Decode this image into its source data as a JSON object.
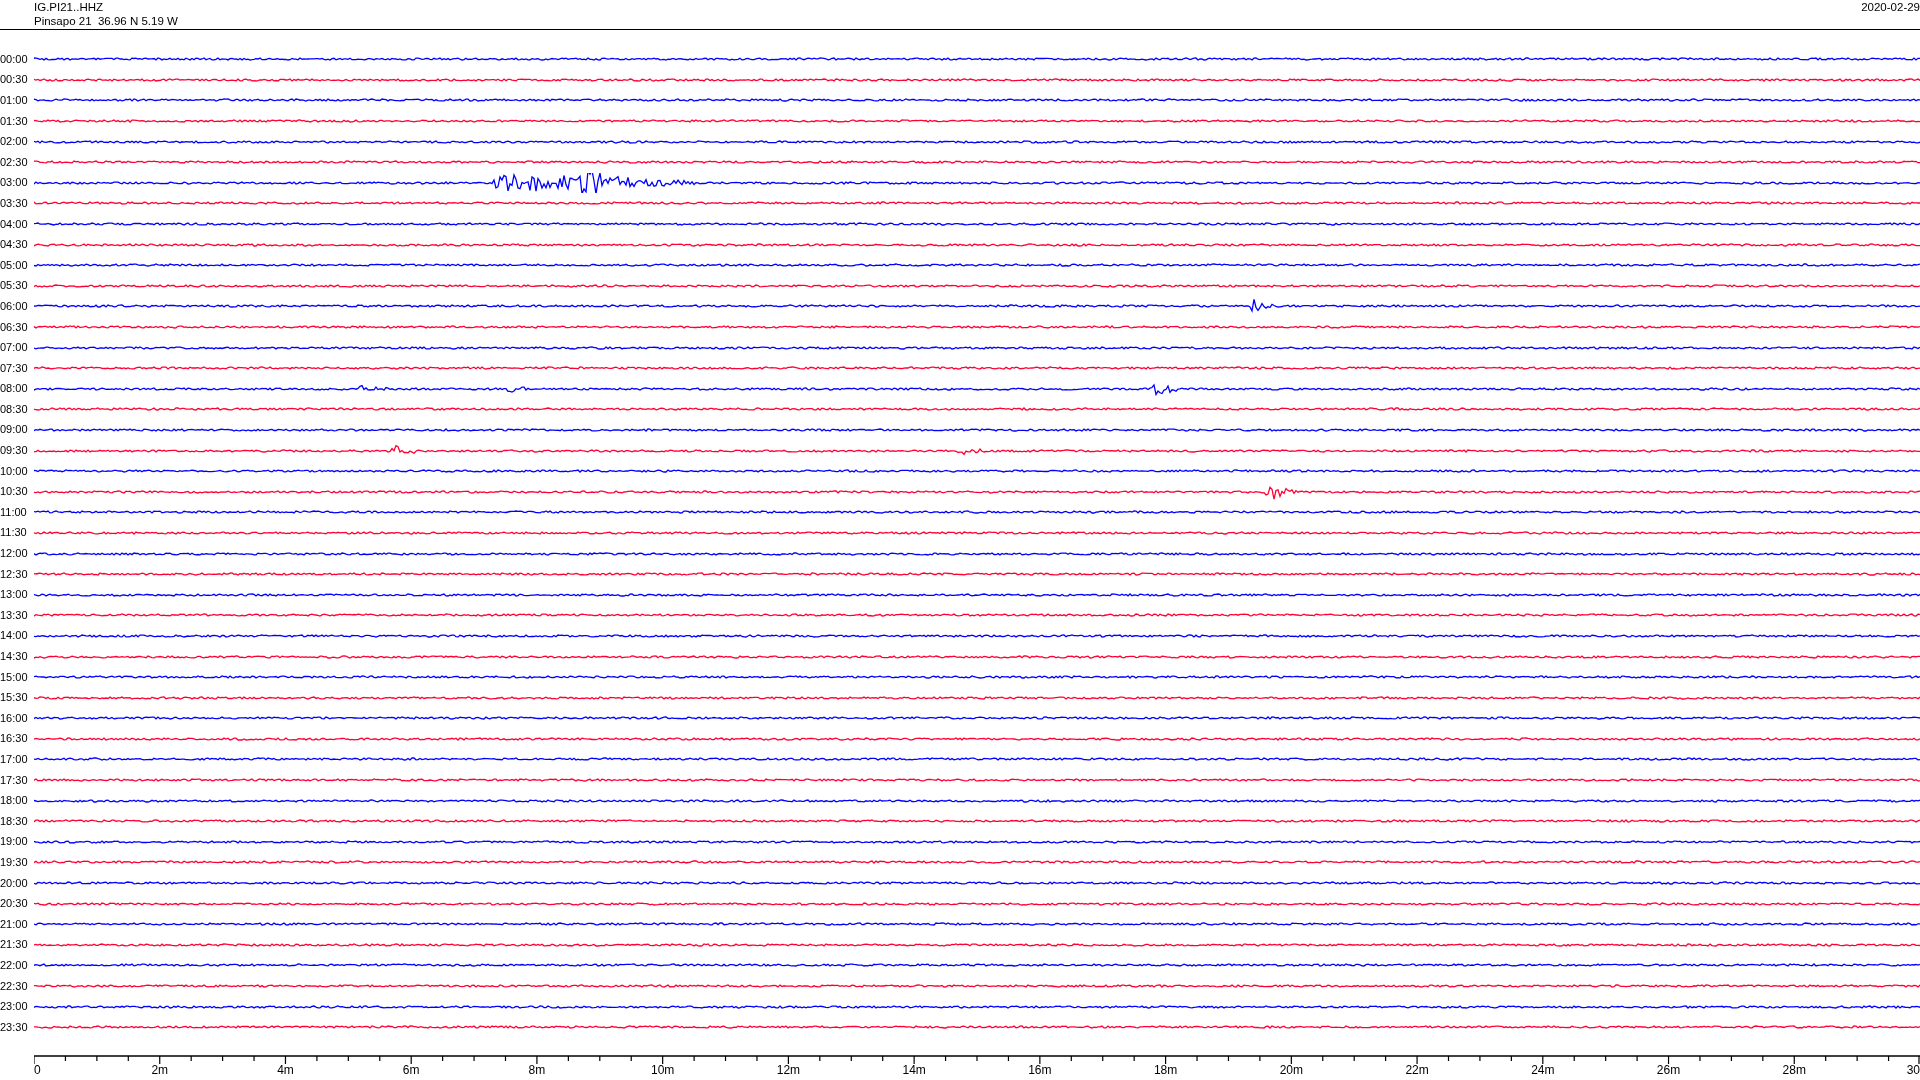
{
  "header": {
    "channel": "IG.PI21..HHZ",
    "station": "Pinsapo 21  36.96 N 5.19 W",
    "date": "2020-02-29"
  },
  "rows": [
    {
      "time": "00:00",
      "color": "#0000ff"
    },
    {
      "time": "00:30",
      "color": "#ff0033"
    },
    {
      "time": "01:00",
      "color": "#0000ff"
    },
    {
      "time": "01:30",
      "color": "#ff0033"
    },
    {
      "time": "02:00",
      "color": "#0000ff"
    },
    {
      "time": "02:30",
      "color": "#ff0033"
    },
    {
      "time": "03:00",
      "color": "#0000ff"
    },
    {
      "time": "03:30",
      "color": "#ff0033"
    },
    {
      "time": "04:00",
      "color": "#0000ff"
    },
    {
      "time": "04:30",
      "color": "#ff0033"
    },
    {
      "time": "05:00",
      "color": "#0000ff"
    },
    {
      "time": "05:30",
      "color": "#ff0033"
    },
    {
      "time": "06:00",
      "color": "#0000ff"
    },
    {
      "time": "06:30",
      "color": "#ff0033"
    },
    {
      "time": "07:00",
      "color": "#0000ff"
    },
    {
      "time": "07:30",
      "color": "#ff0033"
    },
    {
      "time": "08:00",
      "color": "#0000ff"
    },
    {
      "time": "08:30",
      "color": "#ff0033"
    },
    {
      "time": "09:00",
      "color": "#0000ff"
    },
    {
      "time": "09:30",
      "color": "#ff0033"
    },
    {
      "time": "10:00",
      "color": "#0000ff"
    },
    {
      "time": "10:30",
      "color": "#ff0033"
    },
    {
      "time": "11:00",
      "color": "#0000ff"
    },
    {
      "time": "11:30",
      "color": "#ff0033"
    },
    {
      "time": "12:00",
      "color": "#0000ff"
    },
    {
      "time": "12:30",
      "color": "#ff0033"
    },
    {
      "time": "13:00",
      "color": "#0000ff"
    },
    {
      "time": "13:30",
      "color": "#ff0033"
    },
    {
      "time": "14:00",
      "color": "#0000ff"
    },
    {
      "time": "14:30",
      "color": "#ff0033"
    },
    {
      "time": "15:00",
      "color": "#0000ff"
    },
    {
      "time": "15:30",
      "color": "#ff0033"
    },
    {
      "time": "16:00",
      "color": "#0000ff"
    },
    {
      "time": "16:30",
      "color": "#ff0033"
    },
    {
      "time": "17:00",
      "color": "#0000ff"
    },
    {
      "time": "17:30",
      "color": "#ff0033"
    },
    {
      "time": "18:00",
      "color": "#0000ff"
    },
    {
      "time": "18:30",
      "color": "#ff0033"
    },
    {
      "time": "19:00",
      "color": "#0000ff"
    },
    {
      "time": "19:30",
      "color": "#ff0033"
    },
    {
      "time": "20:00",
      "color": "#0000ff"
    },
    {
      "time": "20:30",
      "color": "#ff0033"
    },
    {
      "time": "21:00",
      "color": "#0000ff"
    },
    {
      "time": "21:30",
      "color": "#ff0033"
    },
    {
      "time": "22:00",
      "color": "#0000ff"
    },
    {
      "time": "22:30",
      "color": "#ff0033"
    },
    {
      "time": "23:00",
      "color": "#0000ff"
    },
    {
      "time": "23:30",
      "color": "#ff0033"
    }
  ],
  "x_axis": {
    "tick_labels": [
      "0",
      "2m",
      "4m",
      "6m",
      "8m",
      "10m",
      "12m",
      "14m",
      "16m",
      "18m",
      "20m",
      "22m",
      "24m",
      "26m",
      "28m",
      "30"
    ]
  }
}
